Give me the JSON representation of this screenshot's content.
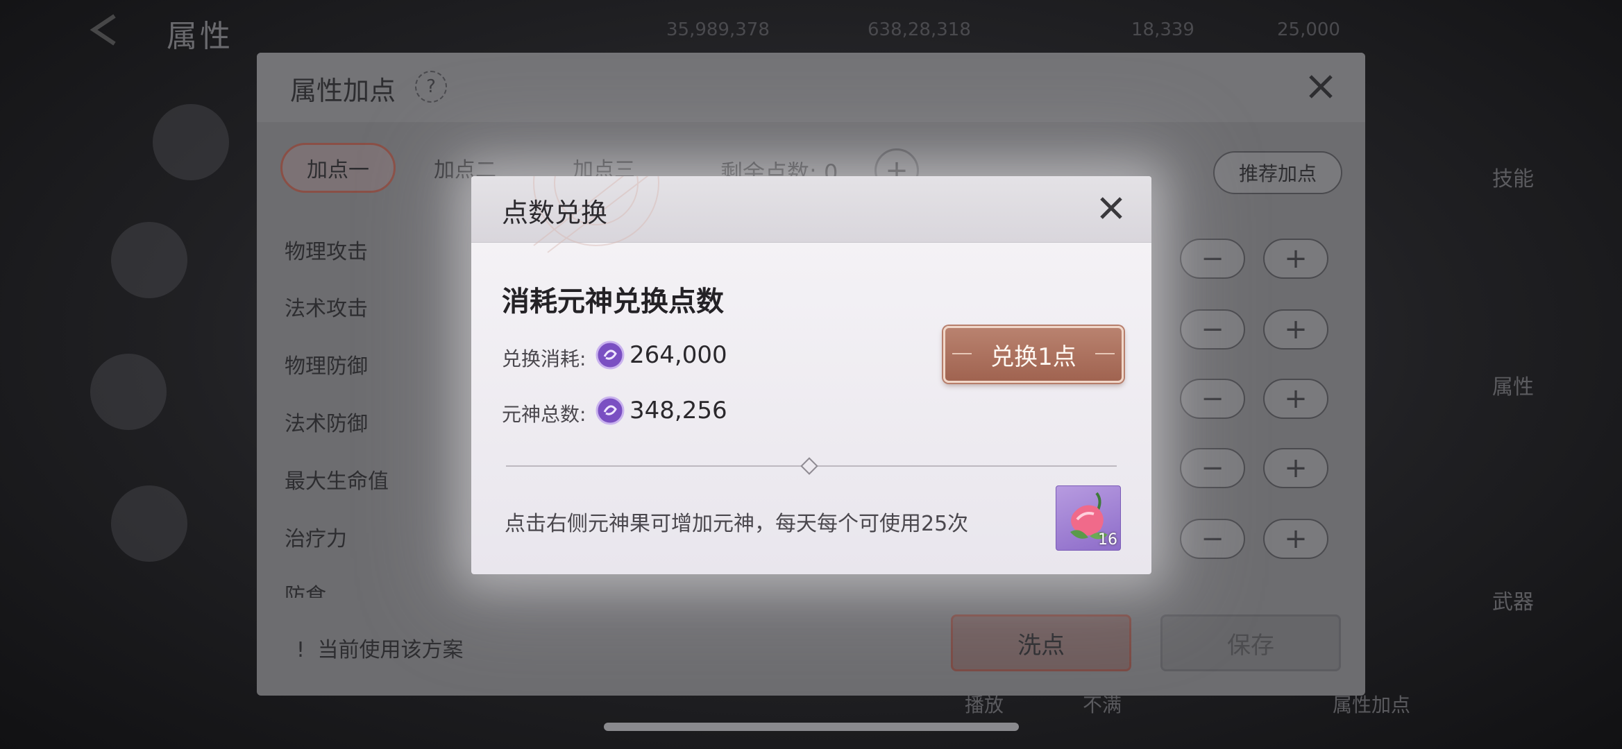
{
  "background": {
    "title": "属性",
    "resources": [
      "35,989,378",
      "638,28,318",
      "18,339",
      "25,000"
    ],
    "right_tabs": [
      "技能",
      "属性",
      "武器"
    ],
    "bottom_labels": [
      "播放",
      "不满",
      "属性加点"
    ]
  },
  "attr_panel": {
    "title": "属性加点",
    "help": "?",
    "tabs": [
      "加点一",
      "加点二",
      "加点三"
    ],
    "remaining_label": "剩余点数:",
    "remaining_value": "0",
    "recommend_label": "推荐加点",
    "stats": [
      "物理攻击",
      "法术攻击",
      "物理防御",
      "法术防御",
      "最大生命值",
      "治疗力",
      "防食"
    ],
    "minus": "−",
    "plus": "+",
    "status_text": "当前使用该方案",
    "reset_label": "洗点",
    "save_label": "保存"
  },
  "modal": {
    "title": "点数兑换",
    "subtitle": "消耗元神兑换点数",
    "cost_label": "兑换消耗:",
    "cost_value": "264,000",
    "total_label": "元神总数:",
    "total_value": "348,256",
    "exchange_label": "兑换1点",
    "hint": "点击右侧元神果可增加元神，每天每个可使用25次",
    "item_count": "16"
  },
  "colors": {
    "accent_button": "#a8695a",
    "modal_bg": "#f1eff4",
    "spirit_icon": "#7a4fc2",
    "fruit_bg": "#a083d6"
  },
  "icons": {
    "close": "close-icon",
    "spirit": "spirit-orb-icon",
    "fruit": "spirit-fruit-icon"
  }
}
